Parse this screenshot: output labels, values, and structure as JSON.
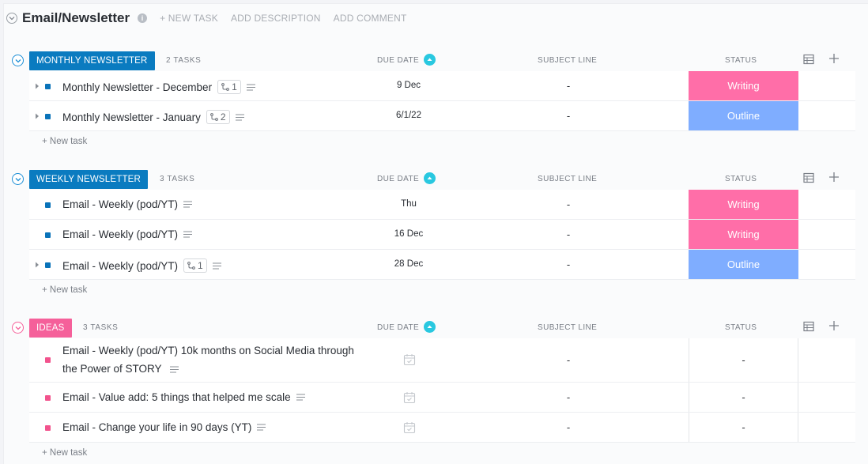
{
  "header": {
    "title": "Email/Newsletter",
    "info_label": "i",
    "actions": [
      "+ NEW TASK",
      "ADD DESCRIPTION",
      "ADD COMMENT"
    ]
  },
  "columns": {
    "due_date": "DUE DATE",
    "subject_line": "SUBJECT LINE",
    "status": "STATUS"
  },
  "colors": {
    "blue_group": "#0a7bc0",
    "pink_group": "#f5609a",
    "writing": "#ff6ea8",
    "outline": "#7fadff",
    "task_dot_blue": "#0a73b9",
    "task_dot_pink": "#f2538d"
  },
  "new_task_label": "+ New task",
  "groups": [
    {
      "label": "MONTHLY NEWSLETTER",
      "count": "2 TASKS",
      "tasks": [
        {
          "name": "Monthly Newsletter - December",
          "subtasks": "1",
          "due": "9 Dec",
          "subject": "-",
          "status": "Writing"
        },
        {
          "name": "Monthly Newsletter - January",
          "subtasks": "2",
          "due": "6/1/22",
          "subject": "-",
          "status": "Outline"
        }
      ]
    },
    {
      "label": "WEEKLY NEWSLETTER",
      "count": "3 TASKS",
      "tasks": [
        {
          "name": "Email - Weekly (pod/YT)",
          "due": "Thu",
          "subject": "-",
          "status": "Writing"
        },
        {
          "name": "Email - Weekly (pod/YT)",
          "due": "16 Dec",
          "subject": "-",
          "status": "Writing"
        },
        {
          "name": "Email - Weekly (pod/YT)",
          "subtasks": "1",
          "due": "28 Dec",
          "subject": "-",
          "status": "Outline"
        }
      ]
    },
    {
      "label": "IDEAS",
      "count": "3 TASKS",
      "tasks": [
        {
          "name": "Email - Weekly (pod/YT) 10k months on Social Media through the Power of STORY",
          "subject": "-",
          "status": "-"
        },
        {
          "name": "Email - Value add: 5 things that helped me scale",
          "subject": "-",
          "status": "-"
        },
        {
          "name": "Email - Change your life in 90 days (YT)",
          "subject": "-",
          "status": "-"
        }
      ]
    }
  ]
}
